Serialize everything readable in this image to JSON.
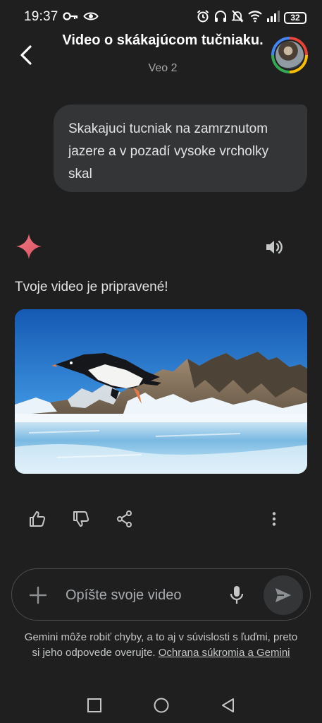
{
  "status_bar": {
    "time": "19:37",
    "battery": "32"
  },
  "header": {
    "title": "Video o skákajúcom tučniaku.",
    "model": "Veo 2"
  },
  "user_message": {
    "text": "Skakajuci tucniak na zamrznutom jazere a v pozadí vysoke vrcholky skal"
  },
  "response": {
    "text": "Tvoje video je pripravené!"
  },
  "input": {
    "placeholder": "Opíšte svoje video"
  },
  "disclaimer": {
    "text": "Gemini môže robiť chyby, a to aj v súvislosti s ľuďmi, preto si jeho odpovede overujte. ",
    "link": "Ochrana súkromia a Gemini"
  },
  "colors": {
    "background": "#1f1f1f",
    "bubble": "#333537",
    "spark": "#e06c75"
  },
  "icons": {
    "status": [
      "key-icon",
      "eye-icon",
      "alarm-icon",
      "headphones-icon",
      "mute-icon",
      "wifi-icon",
      "signal-icon",
      "battery-icon"
    ],
    "actions": [
      "thumb-up-icon",
      "thumb-down-icon",
      "share-icon",
      "more-vert-icon"
    ],
    "nav": [
      "square-icon",
      "circle-icon",
      "triangle-back-icon"
    ]
  }
}
